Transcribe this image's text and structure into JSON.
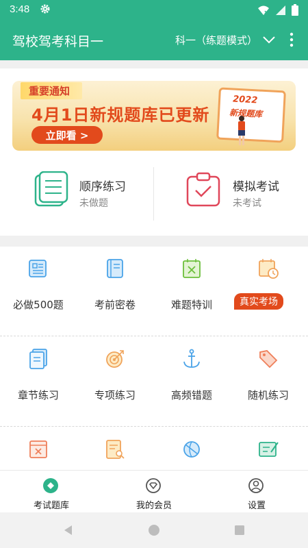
{
  "status_bar": {
    "time": "3:48"
  },
  "app_bar": {
    "title": "驾校驾考科目一",
    "mode": "科一（练题模式）"
  },
  "banner": {
    "tag": "重要通知",
    "headline": "4月1日新规题库已更新",
    "cta": "立即看 >",
    "board_year": "2022",
    "board_text": "新规题库",
    "slide_index": 1,
    "slide_count": 2
  },
  "practice": [
    {
      "name": "顺序练习",
      "sub": "未做题",
      "icon": "list-note-icon"
    },
    {
      "name": "模拟考试",
      "sub": "未考试",
      "icon": "exam-board-icon"
    }
  ],
  "grid": {
    "rows": [
      [
        {
          "label": "必做500题",
          "icon": "newspaper-icon"
        },
        {
          "label": "考前密卷",
          "icon": "book-icon"
        },
        {
          "label": "难题特训",
          "icon": "cross-doc-icon"
        },
        {
          "label": "真实考场",
          "icon": "calendar-clock-icon",
          "badge": true
        }
      ],
      [
        {
          "label": "章节练习",
          "icon": "stack-doc-icon"
        },
        {
          "label": "专项练习",
          "icon": "target-icon"
        },
        {
          "label": "高频错题",
          "icon": "anchor-icon"
        },
        {
          "label": "随机练习",
          "icon": "tags-icon"
        }
      ],
      [
        {
          "label": "",
          "icon": "wrong-doc-icon"
        },
        {
          "label": "",
          "icon": "search-doc-icon"
        },
        {
          "label": "",
          "icon": "globe-icon"
        },
        {
          "label": "",
          "icon": "edit-board-icon"
        }
      ]
    ]
  },
  "bottom_nav": [
    {
      "label": "考试题库",
      "icon": "diamond-icon",
      "active": true
    },
    {
      "label": "我的会员",
      "icon": "vip-icon",
      "active": false
    },
    {
      "label": "设置",
      "icon": "user-icon",
      "active": false
    }
  ],
  "colors": {
    "brand": "#2db38a",
    "accent": "#e24a1c",
    "blue_icon": "#4aa3e8",
    "orange_icon": "#f0a35a"
  }
}
